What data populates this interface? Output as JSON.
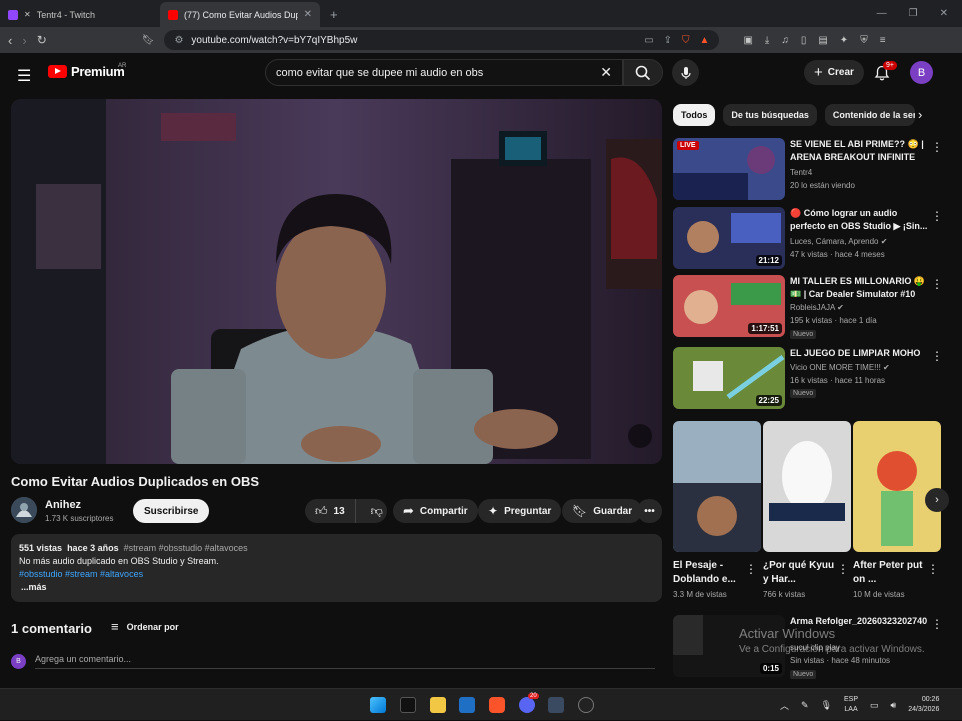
{
  "browser": {
    "tabs": [
      {
        "title": "Tentr4 - Twitch",
        "active": false
      },
      {
        "title": "(77) Como Evitar Audios Duplica...",
        "active": true
      }
    ],
    "url": "youtube.com/watch?v=bY7qIYBhp5w"
  },
  "youtube": {
    "logo_text": "Premium",
    "logo_region": "AR",
    "search_query": "como evitar que se dupee mi audio en obs",
    "create_label": "Crear",
    "notif_badge": "9+",
    "avatar_letter": "B"
  },
  "video": {
    "title": "Como Evitar Audios Duplicados en OBS",
    "channel": "Anihez",
    "subscribers": "1.73 K suscriptores",
    "subscribe_label": "Suscribirse",
    "likes": "13",
    "share_label": "Compartir",
    "ask_label": "Preguntar",
    "save_label": "Guardar",
    "desc_views": "551 vistas",
    "desc_date": "hace 3 años",
    "desc_tags": "#stream #obsstudio #altavoces",
    "desc_text": "No más audio duplicado en OBS Studio y Stream.",
    "desc_links": "#obsstudio #stream #altavoces",
    "desc_more": "...más"
  },
  "comments": {
    "count": "1 comentario",
    "sort_label": "Ordenar por",
    "avatar_letter": "B",
    "placeholder": "Agrega un comentario..."
  },
  "chips": [
    "Todos",
    "De tus búsquedas",
    "Contenido de la ser"
  ],
  "recommendations": [
    {
      "title": "SE VIENE EL ABI PRIME?? 😳 | ARENA BREAKOUT INFINITE E...",
      "channel": "Tentr4",
      "views": "20 lo están viendo",
      "badge": "LIVE",
      "duration": "",
      "new": ""
    },
    {
      "title": "🔴 Cómo lograr un audio perfecto en OBS Studio ▶ ¡Sin...",
      "channel": "Luces, Cámara, Aprendo ✔",
      "views": "47 k vistas · hace 4 meses",
      "badge": "",
      "duration": "21:12",
      "new": ""
    },
    {
      "title": "MI TALLER ES MILLONARIO 🤑 💵 | Car Dealer Simulator #10",
      "channel": "RobleisJAJA ✔",
      "views": "195 k vistas · hace 1 día",
      "badge": "",
      "duration": "1:17:51",
      "new": "Nuevo"
    },
    {
      "title": "EL JUEGO DE LIMPIAR MOHO",
      "channel": "Vicio ONE MORE TIME!!! ✔",
      "views": "16 k vistas · hace 11 horas",
      "badge": "",
      "duration": "22:25",
      "new": "Nuevo"
    }
  ],
  "shorts": [
    {
      "title": "El Pesaje - Doblando e...",
      "views": "3.3 M de vistas"
    },
    {
      "title": "¿Por qué Kyuu y Har...",
      "views": "766 k vistas"
    },
    {
      "title": "After Peter put on ...",
      "views": "10 M de vistas"
    }
  ],
  "last_rec": {
    "title": "Arma Refolger_20260323202740",
    "channel": "sucul clip play",
    "views": "Sin vistas · hace 48 minutos",
    "duration": "0:15",
    "new": "Nuevo"
  },
  "watermark": {
    "line1": "Activar Windows",
    "line2": "Ve a Configuración para activar Windows."
  },
  "taskbar": {
    "lang1": "ESP",
    "lang2": "LAA",
    "time": "00:26",
    "date": "24/3/2026",
    "discord_badge": "20"
  },
  "colors": {
    "accent": "#ff0000",
    "link": "#3ea6ff",
    "bg": "#0f0f0f"
  }
}
